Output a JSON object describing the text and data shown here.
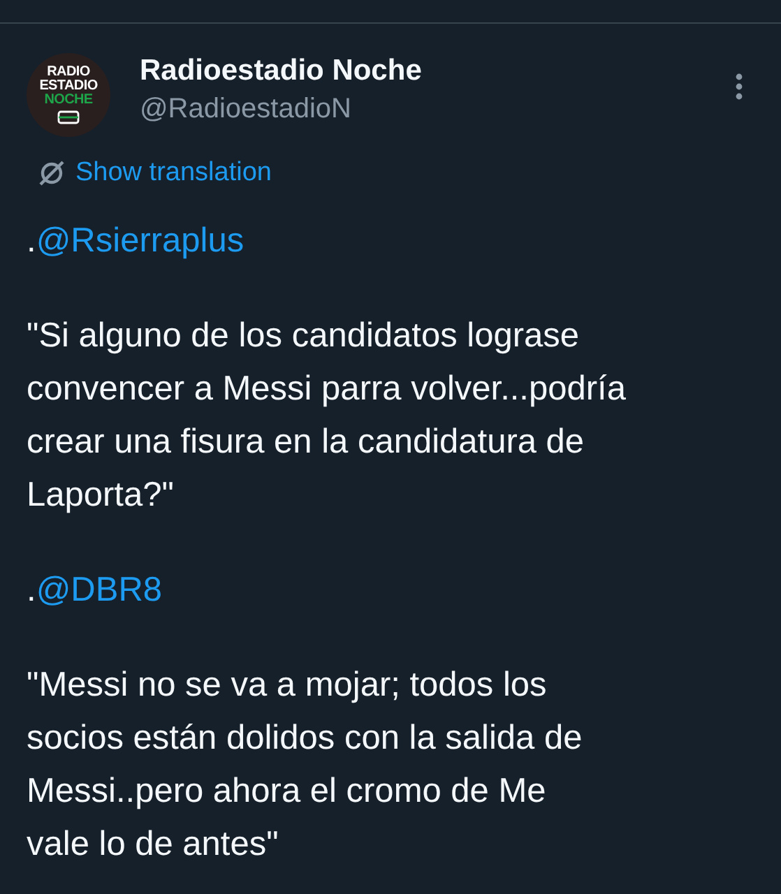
{
  "author": {
    "name": "Radioestadio Noche",
    "handle": "@RadioestadioN",
    "avatar_lines": [
      "RADIO",
      "ESTADIO",
      "NOCHE"
    ]
  },
  "translation_link": "Show translation",
  "body": [
    {
      "kind": "mention",
      "prefix": ".",
      "handle": "@Rsierraplus"
    },
    {
      "kind": "quote",
      "lines": [
        "\"Si alguno de los candidatos lograse",
        "convencer a Messi parra volver...podría",
        "crear una fisura en la candidatura de",
        "Laporta?\""
      ]
    },
    {
      "kind": "mention",
      "prefix": ".",
      "handle": "@DBR8"
    },
    {
      "kind": "quote",
      "lines": [
        "\"Messi no se va a mojar; todos los",
        "socios están dolidos con la salida de",
        "Messi..pero ahora el cromo de Me",
        "vale lo de antes\""
      ]
    }
  ]
}
